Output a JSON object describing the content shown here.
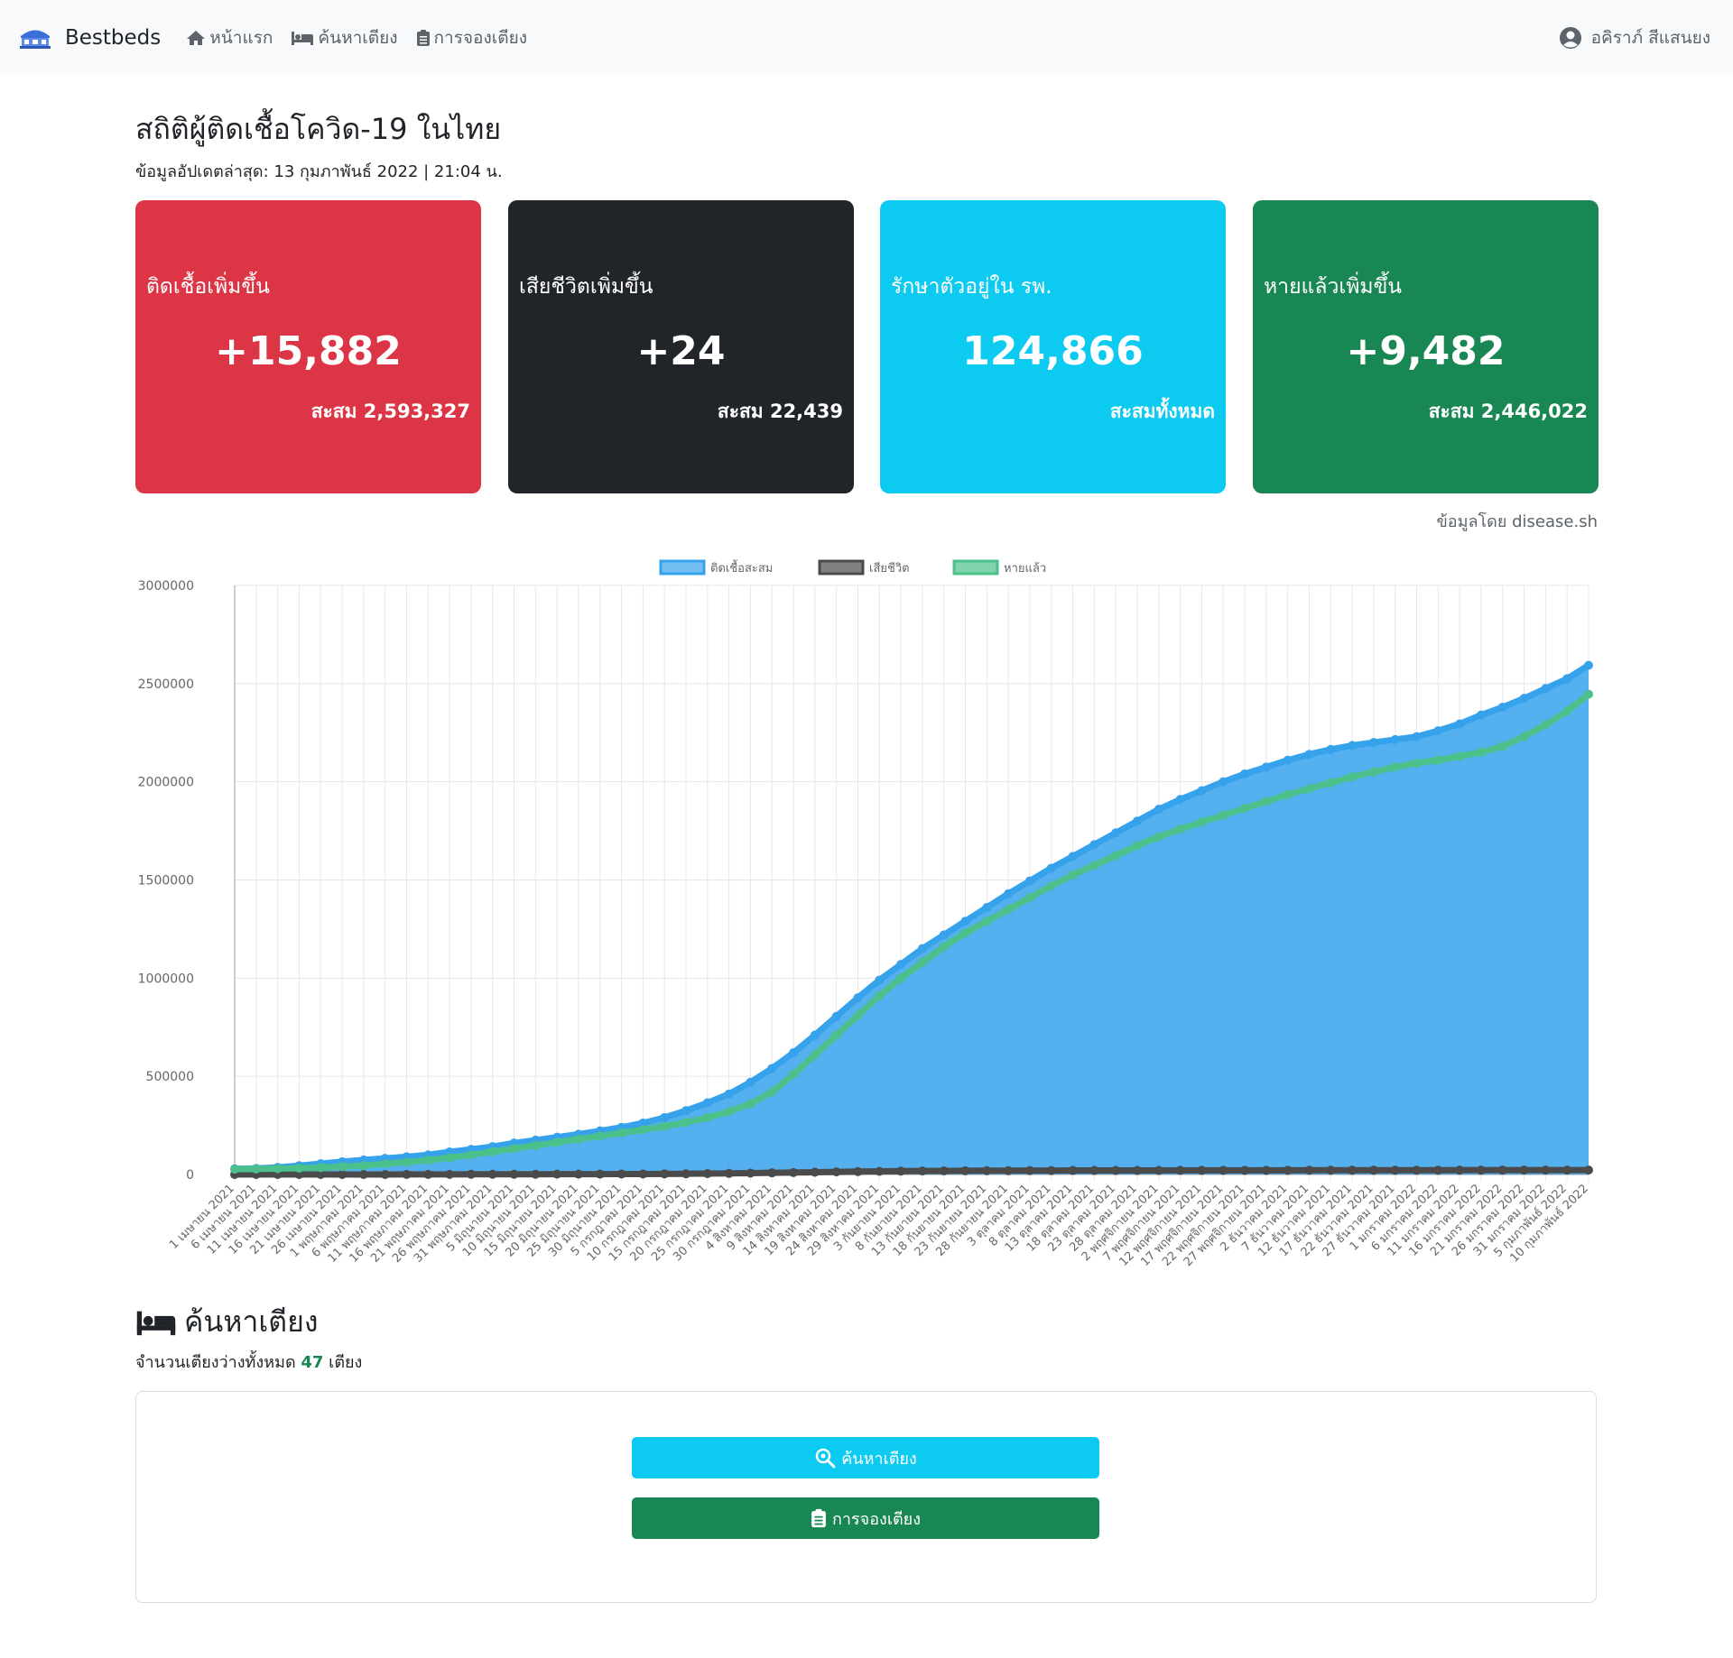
{
  "navbar": {
    "brand": "Bestbeds",
    "brand_icon": "bed-logo-icon",
    "links": [
      {
        "label": "หน้าแรก",
        "icon": "home-icon"
      },
      {
        "label": "ค้นหาเตียง",
        "icon": "bed-icon"
      },
      {
        "label": "การจองเตียง",
        "icon": "clipboard-icon"
      }
    ],
    "user": {
      "name": "อคิราภ์ สีแสนยง",
      "icon": "user-circle-icon"
    }
  },
  "page": {
    "title": "สถิติผู้ติดเชื้อโควิด-19 ในไทย",
    "updated": "ข้อมูลอัปเดตล่าสุด: 13 กุมภาพันธ์ 2022 | 21:04 น.",
    "source": "ข้อมูลโดย disease.sh"
  },
  "cards": [
    {
      "title": "ติดเชื้อเพิ่มขึ้น",
      "value": "+15,882",
      "sub": "สะสม 2,593,327",
      "color": "#dc3545"
    },
    {
      "title": "เสียชีวิตเพิ่มขึ้น",
      "value": "+24",
      "sub": "สะสม 22,439",
      "color": "#212529"
    },
    {
      "title": "รักษาตัวอยู่ใน รพ.",
      "value": "124,866",
      "sub": "สะสมทั้งหมด",
      "color": "#0dcaf0"
    },
    {
      "title": "หายแล้วเพิ่มขึ้น",
      "value": "+9,482",
      "sub": "สะสม 2,446,022",
      "color": "#198754"
    }
  ],
  "chart_data": {
    "type": "area",
    "title": "",
    "legend_position": "top",
    "grid": true,
    "ylim": [
      0,
      3000000
    ],
    "yticks": [
      0,
      500000,
      1000000,
      1500000,
      2000000,
      2500000,
      3000000
    ],
    "x": [
      "1 เมษายน 2021",
      "6 เมษายน 2021",
      "11 เมษายน 2021",
      "16 เมษายน 2021",
      "21 เมษายน 2021",
      "26 เมษายน 2021",
      "1 พฤษภาคม 2021",
      "6 พฤษภาคม 2021",
      "11 พฤษภาคม 2021",
      "16 พฤษภาคม 2021",
      "21 พฤษภาคม 2021",
      "26 พฤษภาคม 2021",
      "31 พฤษภาคม 2021",
      "5 มิถุนายน 2021",
      "10 มิถุนายน 2021",
      "15 มิถุนายน 2021",
      "20 มิถุนายน 2021",
      "25 มิถุนายน 2021",
      "30 มิถุนายน 2021",
      "5 กรกฎาคม 2021",
      "10 กรกฎาคม 2021",
      "15 กรกฎาคม 2021",
      "20 กรกฎาคม 2021",
      "25 กรกฎาคม 2021",
      "30 กรกฎาคม 2021",
      "4 สิงหาคม 2021",
      "9 สิงหาคม 2021",
      "14 สิงหาคม 2021",
      "19 สิงหาคม 2021",
      "24 สิงหาคม 2021",
      "29 สิงหาคม 2021",
      "3 กันยายน 2021",
      "8 กันยายน 2021",
      "13 กันยายน 2021",
      "18 กันยายน 2021",
      "23 กันยายน 2021",
      "28 กันยายน 2021",
      "3 ตุลาคม 2021",
      "8 ตุลาคม 2021",
      "13 ตุลาคม 2021",
      "18 ตุลาคม 2021",
      "23 ตุลาคม 2021",
      "28 ตุลาคม 2021",
      "2 พฤศจิกายน 2021",
      "7 พฤศจิกายน 2021",
      "12 พฤศจิกายน 2021",
      "17 พฤศจิกายน 2021",
      "22 พฤศจิกายน 2021",
      "27 พฤศจิกายน 2021",
      "2 ธันวาคม 2021",
      "7 ธันวาคม 2021",
      "12 ธันวาคม 2021",
      "17 ธันวาคม 2021",
      "22 ธันวาคม 2021",
      "27 ธันวาคม 2021",
      "1 มกราคม 2022",
      "6 มกราคม 2022",
      "11 มกราคม 2022",
      "16 มกราคม 2022",
      "21 มกราคม 2022",
      "26 มกราคม 2022",
      "31 มกราคม 2022",
      "5 กุมภาพันธ์ 2022",
      "10 กุมภาพันธ์ 2022"
    ],
    "series": [
      {
        "name": "ติดเชื้อสะสม",
        "color": "#36a2eb",
        "values": [
          29000,
          31000,
          36000,
          45000,
          55000,
          65000,
          74000,
          82000,
          90000,
          100000,
          115000,
          128000,
          142000,
          160000,
          175000,
          190000,
          205000,
          222000,
          240000,
          262000,
          290000,
          325000,
          365000,
          410000,
          470000,
          540000,
          620000,
          710000,
          805000,
          900000,
          990000,
          1070000,
          1150000,
          1220000,
          1290000,
          1360000,
          1430000,
          1495000,
          1560000,
          1620000,
          1680000,
          1740000,
          1800000,
          1860000,
          1910000,
          1955000,
          2000000,
          2040000,
          2075000,
          2110000,
          2140000,
          2165000,
          2185000,
          2200000,
          2215000,
          2230000,
          2260000,
          2295000,
          2340000,
          2380000,
          2425000,
          2475000,
          2525000,
          2593327
        ]
      },
      {
        "name": "เสียชีวิต",
        "color": "#4b4b4b",
        "values": [
          94,
          96,
          98,
          104,
          118,
          140,
          190,
          250,
          320,
          400,
          620,
          900,
          1100,
          1280,
          1430,
          1600,
          1800,
          2000,
          2250,
          2500,
          3000,
          3700,
          4600,
          5600,
          7000,
          8400,
          9900,
          11500,
          13200,
          14700,
          16000,
          17200,
          18000,
          18600,
          19100,
          19500,
          19800,
          20000,
          20200,
          20400,
          20600,
          20700,
          20800,
          20900,
          21000,
          21100,
          21200,
          21300,
          21400,
          21500,
          21600,
          21700,
          21800,
          21900,
          22000,
          22050,
          22100,
          22150,
          22200,
          22250,
          22300,
          22350,
          22400,
          22439
        ]
      },
      {
        "name": "หายแล้ว",
        "color": "#4bc08a",
        "values": [
          27000,
          28000,
          30000,
          32000,
          35000,
          40000,
          46000,
          54000,
          63000,
          73000,
          86000,
          100000,
          116000,
          132000,
          148000,
          164000,
          180000,
          196000,
          212000,
          228000,
          245000,
          265000,
          290000,
          320000,
          360000,
          420000,
          510000,
          610000,
          710000,
          810000,
          910000,
          1000000,
          1080000,
          1160000,
          1230000,
          1290000,
          1350000,
          1410000,
          1470000,
          1525000,
          1575000,
          1625000,
          1675000,
          1720000,
          1760000,
          1795000,
          1830000,
          1865000,
          1900000,
          1935000,
          1965000,
          1995000,
          2025000,
          2050000,
          2075000,
          2095000,
          2110000,
          2130000,
          2150000,
          2180000,
          2230000,
          2290000,
          2360000,
          2446022
        ]
      }
    ]
  },
  "beds": {
    "icon": "bed-icon",
    "heading": "ค้นหาเตียง",
    "count_prefix": "จำนวนเตียงว่างทั้งหมด",
    "count": "47",
    "count_suffix": "เตียง",
    "search_button": {
      "label": "ค้นหาเตียง",
      "icon": "search-icon"
    },
    "book_button": {
      "label": "การจองเตียง",
      "icon": "clipboard-icon"
    }
  }
}
